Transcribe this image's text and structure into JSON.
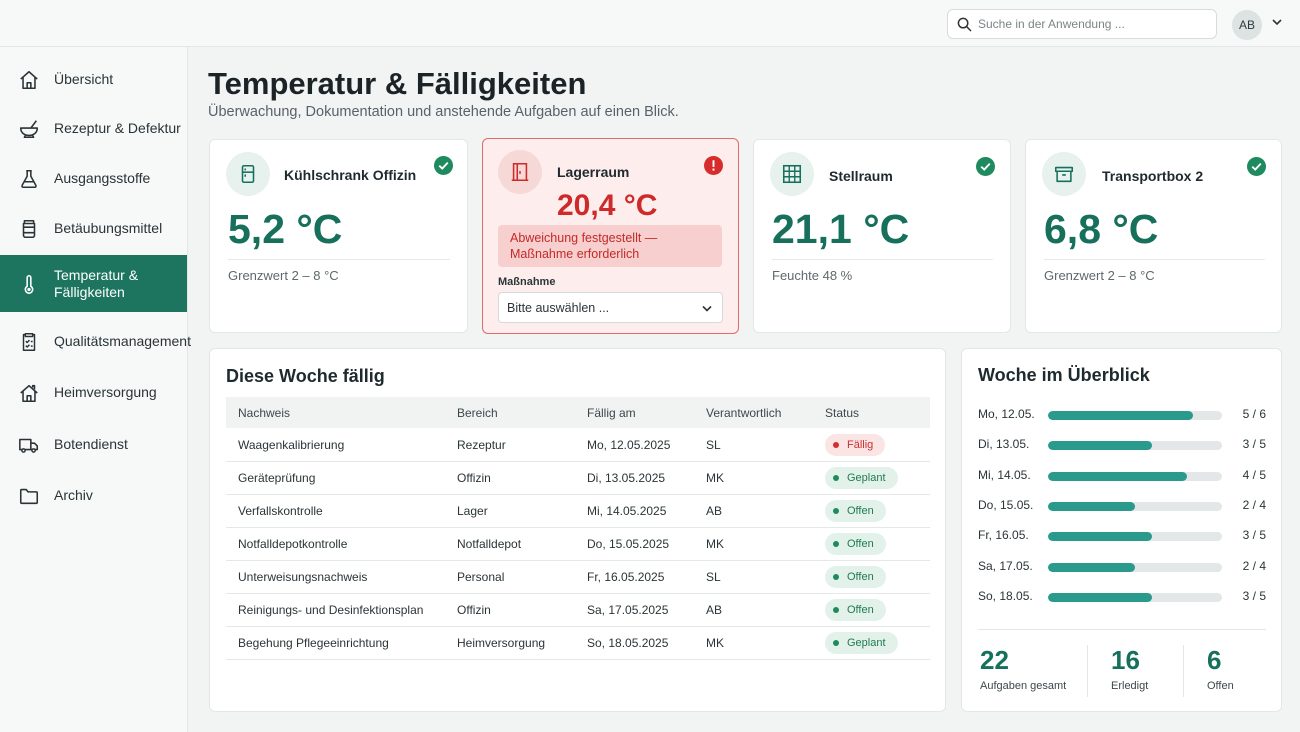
{
  "header": {
    "search_placeholder": "Suche in der Anwendung ...",
    "user_initials": "AB"
  },
  "sidebar": {
    "items": [
      {
        "label": "Übersicht",
        "icon": "home-icon"
      },
      {
        "label": "Rezeptur & Defektur",
        "icon": "mortar-pestle-icon"
      },
      {
        "label": "Ausgangsstoffe",
        "icon": "flask-icon"
      },
      {
        "label": "Betäubungsmittel",
        "icon": "pill-jar-icon"
      },
      {
        "label": "Temperatur & Fälligkeiten",
        "icon": "thermometer-icon",
        "active": true
      },
      {
        "label": "Qualitätsmanagement",
        "icon": "clipboard-check-icon"
      },
      {
        "label": "Heimversorgung",
        "icon": "house-icon"
      },
      {
        "label": "Botendienst",
        "icon": "truck-icon"
      },
      {
        "label": "Archiv",
        "icon": "folder-icon"
      }
    ]
  },
  "page": {
    "title": "Temperatur & Fälligkeiten",
    "subtitle": "Überwachung, Dokumentation und anstehende Aufgaben auf einen Blick."
  },
  "sensors": [
    {
      "name": "Kühlschrank Offizin",
      "temp": "5,2 °C",
      "meta": "Grenzwert 2 – 8 °C",
      "status": "ok",
      "icon": "fridge-icon"
    },
    {
      "name": "Lagerraum",
      "temp": "20,4 °C",
      "status": "alert",
      "icon": "door-icon",
      "alert_text": "Abweichung festgestellt — Maßnahme erforderlich",
      "measure_label": "Maßnahme",
      "measure_select": "Bitte auswählen ..."
    },
    {
      "name": "Stellraum",
      "temp": "21,1 °C",
      "meta": "Feuchte 48 %",
      "status": "ok",
      "icon": "shelf-icon"
    },
    {
      "name": "Transportbox 2",
      "temp": "6,8 °C",
      "meta": "Grenzwert 2 – 8 °C",
      "status": "ok",
      "icon": "box-icon"
    }
  ],
  "due_table": {
    "title": "Diese Woche fällig",
    "columns": [
      "Nachweis",
      "Bereich",
      "Fällig am",
      "Verantwortlich",
      "Status"
    ],
    "rows": [
      [
        "Waagenkalibrierung",
        "Rezeptur",
        "Mo, 12.05.2025",
        "SL",
        "Fällig"
      ],
      [
        "Geräteprüfung",
        "Offizin",
        "Di, 13.05.2025",
        "MK",
        "Geplant"
      ],
      [
        "Verfallskontrolle",
        "Lager",
        "Mi, 14.05.2025",
        "AB",
        "Offen"
      ],
      [
        "Notfalldepotkontrolle",
        "Notfalldepot",
        "Do, 15.05.2025",
        "MK",
        "Offen"
      ],
      [
        "Unterweisungsnachweis",
        "Personal",
        "Fr, 16.05.2025",
        "SL",
        "Offen"
      ],
      [
        "Reinigungs- und Desinfektionsplan",
        "Offizin",
        "Sa, 17.05.2025",
        "AB",
        "Offen"
      ],
      [
        "Begehung Pflegeeinrichtung",
        "Heimversorgung",
        "So, 18.05.2025",
        "MK",
        "Geplant"
      ]
    ]
  },
  "week": {
    "title": "Woche im Überblick",
    "days": [
      {
        "day": "Mo, 12.05.",
        "done": 5,
        "total": 6,
        "label": "5 / 6"
      },
      {
        "day": "Di, 13.05.",
        "done": 3,
        "total": 5,
        "label": "3 / 5"
      },
      {
        "day": "Mi, 14.05.",
        "done": 4,
        "total": 5,
        "label": "4 / 5"
      },
      {
        "day": "Do, 15.05.",
        "done": 2,
        "total": 4,
        "label": "2 / 4"
      },
      {
        "day": "Fr, 16.05.",
        "done": 3,
        "total": 5,
        "label": "3 / 5"
      },
      {
        "day": "Sa, 17.05.",
        "done": 2,
        "total": 4,
        "label": "2 / 4"
      },
      {
        "day": "So, 18.05.",
        "done": 3,
        "total": 5,
        "label": "3 / 5"
      }
    ],
    "stats": [
      {
        "value": "22",
        "label": "Aufgaben gesamt"
      },
      {
        "value": "16",
        "label": "Erledigt"
      },
      {
        "value": "6",
        "label": "Offen"
      }
    ]
  },
  "colors": {
    "accent": "#1d7560",
    "alert": "#cf2a2a",
    "progress": "#2a9a8c"
  }
}
